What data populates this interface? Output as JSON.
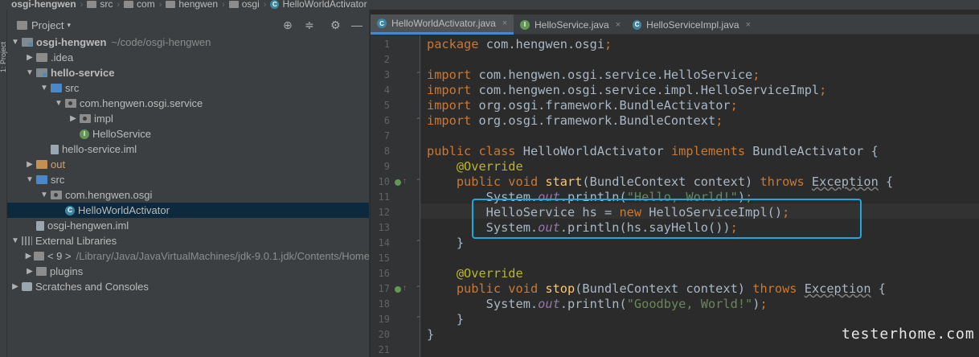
{
  "breadcrumb": {
    "items": [
      "osgi-hengwen",
      "src",
      "com",
      "hengwen",
      "osgi",
      "HelloWorldActivator"
    ]
  },
  "left_strip": {
    "label": "1: Project"
  },
  "project_panel": {
    "title": "Project",
    "caret": "▾",
    "tools": {
      "locate": "⊕",
      "collapse": "≑",
      "settings": "⚙",
      "hide": "—"
    },
    "tree": [
      {
        "label": "osgi-hengwen",
        "sub": "~/code/osgi-hengwen",
        "icon": "module-icon",
        "arrow": "▼",
        "bold": true,
        "indent": 0
      },
      {
        "label": ".idea",
        "icon": "folder-icon",
        "arrow": "▶",
        "indent": 1
      },
      {
        "label": "hello-service",
        "icon": "module-icon",
        "arrow": "▼",
        "bold": true,
        "indent": 1
      },
      {
        "label": "src",
        "icon": "source-folder-icon",
        "arrow": "▼",
        "indent": 2
      },
      {
        "label": "com.hengwen.osgi.service",
        "icon": "package-icon",
        "arrow": "▼",
        "indent": 3
      },
      {
        "label": "impl",
        "icon": "package-icon",
        "arrow": "▶",
        "indent": 4
      },
      {
        "label": "HelloService",
        "icon": "interface-icon",
        "arrow": "",
        "indent": 4
      },
      {
        "label": "hello-service.iml",
        "icon": "iml-file-icon",
        "arrow": "",
        "indent": 2
      },
      {
        "label": "out",
        "icon": "excluded-folder-icon",
        "arrow": "▶",
        "orange": true,
        "indent": 1
      },
      {
        "label": "src",
        "icon": "source-folder-icon",
        "arrow": "▼",
        "indent": 1
      },
      {
        "label": "com.hengwen.osgi",
        "icon": "package-icon",
        "arrow": "▼",
        "indent": 2
      },
      {
        "label": "HelloWorldActivator",
        "icon": "class-icon",
        "arrow": "",
        "selected": true,
        "indent": 3
      },
      {
        "label": "osgi-hengwen.iml",
        "icon": "iml-file-icon",
        "arrow": "",
        "indent": 1
      },
      {
        "label": "External Libraries",
        "icon": "library-icon",
        "arrow": "▼",
        "indent": 0
      },
      {
        "label": "< 9 >",
        "sub": "/Library/Java/JavaVirtualMachines/jdk-9.0.1.jdk/Contents/Home",
        "icon": "jdk-icon",
        "arrow": "▶",
        "indent": 1
      },
      {
        "label": "plugins",
        "icon": "jdk-icon",
        "arrow": "▶",
        "indent": 1
      },
      {
        "label": "Scratches and Consoles",
        "icon": "scratches-icon",
        "arrow": "▶",
        "indent": 0
      }
    ]
  },
  "editor": {
    "tabs": [
      {
        "label": "HelloWorldActivator.java",
        "icon_letter": "C",
        "icon_color": "#3e86a0",
        "active": true,
        "close": "×"
      },
      {
        "label": "HelloService.java",
        "icon_letter": "I",
        "icon_color": "#629755",
        "active": false,
        "close": "×"
      },
      {
        "label": "HelloServiceImpl.java",
        "icon_letter": "C",
        "icon_color": "#3e86a0",
        "active": false,
        "close": "×"
      }
    ],
    "caret_line": 12,
    "lines": [
      [
        [
          "kw",
          "package"
        ],
        [
          "",
          "com.hengwen.osgi"
        ],
        [
          "kw",
          ";"
        ]
      ],
      [],
      [
        [
          "kw",
          "import"
        ],
        [
          "",
          "com.hengwen.osgi.service.HelloService"
        ],
        [
          "kw",
          ";"
        ]
      ],
      [
        [
          "kw",
          "import"
        ],
        [
          "",
          "com.hengwen.osgi.service.impl.HelloServiceImpl"
        ],
        [
          "kw",
          ";"
        ]
      ],
      [
        [
          "kw",
          "import"
        ],
        [
          "",
          "org.osgi.framework.BundleActivator"
        ],
        [
          "kw",
          ";"
        ]
      ],
      [
        [
          "kw",
          "import"
        ],
        [
          "",
          "org.osgi.framework.BundleContext"
        ],
        [
          "kw",
          ";"
        ]
      ],
      [],
      [
        [
          "kw",
          "public class "
        ],
        [
          "",
          "HelloWorldActivator "
        ],
        [
          "kw",
          "implements "
        ],
        [
          "",
          "BundleActivator {"
        ]
      ],
      [
        [
          "",
          "    "
        ],
        [
          "an",
          "@Override"
        ]
      ],
      [
        [
          "",
          "    "
        ],
        [
          "kw",
          "public void "
        ],
        [
          "mt",
          "start"
        ],
        [
          "",
          "(BundleContext context) "
        ],
        [
          "kw",
          "throws "
        ],
        [
          "warn",
          "Exception"
        ],
        [
          "",
          " {"
        ]
      ],
      [
        [
          "",
          "        System."
        ],
        [
          "fd",
          "out"
        ],
        [
          "",
          ".println("
        ],
        [
          "st",
          "\"Hello, World!\""
        ],
        [
          "",
          ")"
        ],
        [
          "kw",
          ";"
        ]
      ],
      [
        [
          "",
          "        HelloService hs = "
        ],
        [
          "kw",
          "new "
        ],
        [
          "",
          "HelloServiceImpl()"
        ],
        [
          "kw",
          ";"
        ]
      ],
      [
        [
          "",
          "        System."
        ],
        [
          "fd",
          "out"
        ],
        [
          "",
          ".println(hs.sayHello())"
        ],
        [
          "kw",
          ";"
        ]
      ],
      [
        [
          "",
          "    }"
        ]
      ],
      [],
      [
        [
          "",
          "    "
        ],
        [
          "an",
          "@Override"
        ]
      ],
      [
        [
          "",
          "    "
        ],
        [
          "kw",
          "public void "
        ],
        [
          "mt",
          "stop"
        ],
        [
          "",
          "(BundleContext context) "
        ],
        [
          "kw",
          "throws "
        ],
        [
          "warn",
          "Exception"
        ],
        [
          "",
          " {"
        ]
      ],
      [
        [
          "",
          "        System."
        ],
        [
          "fd",
          "out"
        ],
        [
          "",
          ".println("
        ],
        [
          "st",
          "\"Goodbye, World!\""
        ],
        [
          "",
          ")"
        ],
        [
          "kw",
          ";"
        ]
      ],
      [
        [
          "",
          "    }"
        ]
      ],
      [
        [
          "",
          "}"
        ]
      ],
      []
    ]
  },
  "watermark": "testerhome.com"
}
